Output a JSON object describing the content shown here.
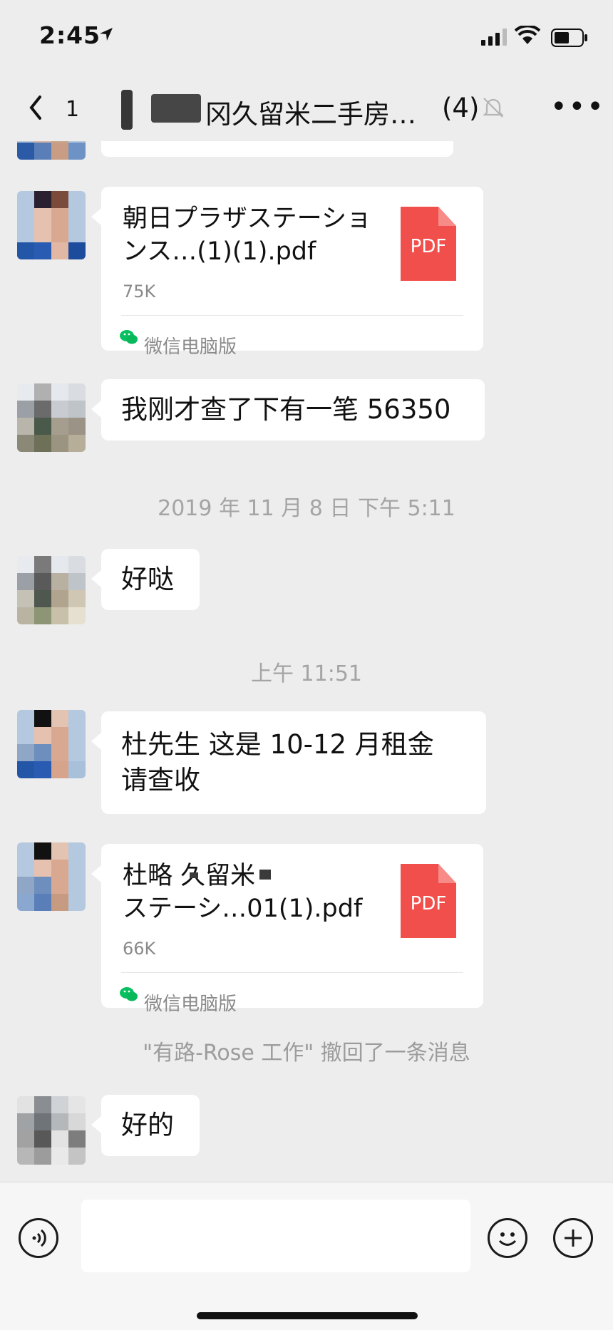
{
  "status_bar": {
    "time": "2:45"
  },
  "nav": {
    "unread_count": "1",
    "title": "冈久留米二手房…",
    "member_count": "(4)"
  },
  "messages": {
    "file1": {
      "name": "朝日プラザステーションス…(1)(1).pdf",
      "size": "75K",
      "source": "微信电脑版",
      "badge": "PDF"
    },
    "text1": "我刚才查了下有一笔 56350",
    "time1": "2019 年 11 月 8 日 下午 5:11",
    "text2": "好哒",
    "time2": "上午 11:51",
    "text3": "杜先生 这是 10-12 月租金 请查收",
    "file2": {
      "name_line1": "杜略  久留米",
      "name_line2": "ステーシ…01(1).pdf",
      "size": "66K",
      "source": "微信电脑版",
      "badge": "PDF"
    },
    "recall_notice": "\"有路-Rose 工作\" 撤回了一条消息",
    "text4": "好的"
  },
  "colors": {
    "pdf_red": "#f14f4b",
    "bubble": "#ffffff",
    "background": "#ededed",
    "wechat_green": "#07c160"
  },
  "icons": [
    "location-arrow-icon",
    "signal-icon",
    "wifi-icon",
    "battery-icon",
    "back-chevron-icon",
    "mute-bell-icon",
    "more-icon",
    "pdf-icon",
    "wechat-icon",
    "voice-icon",
    "emoji-icon",
    "plus-icon"
  ]
}
